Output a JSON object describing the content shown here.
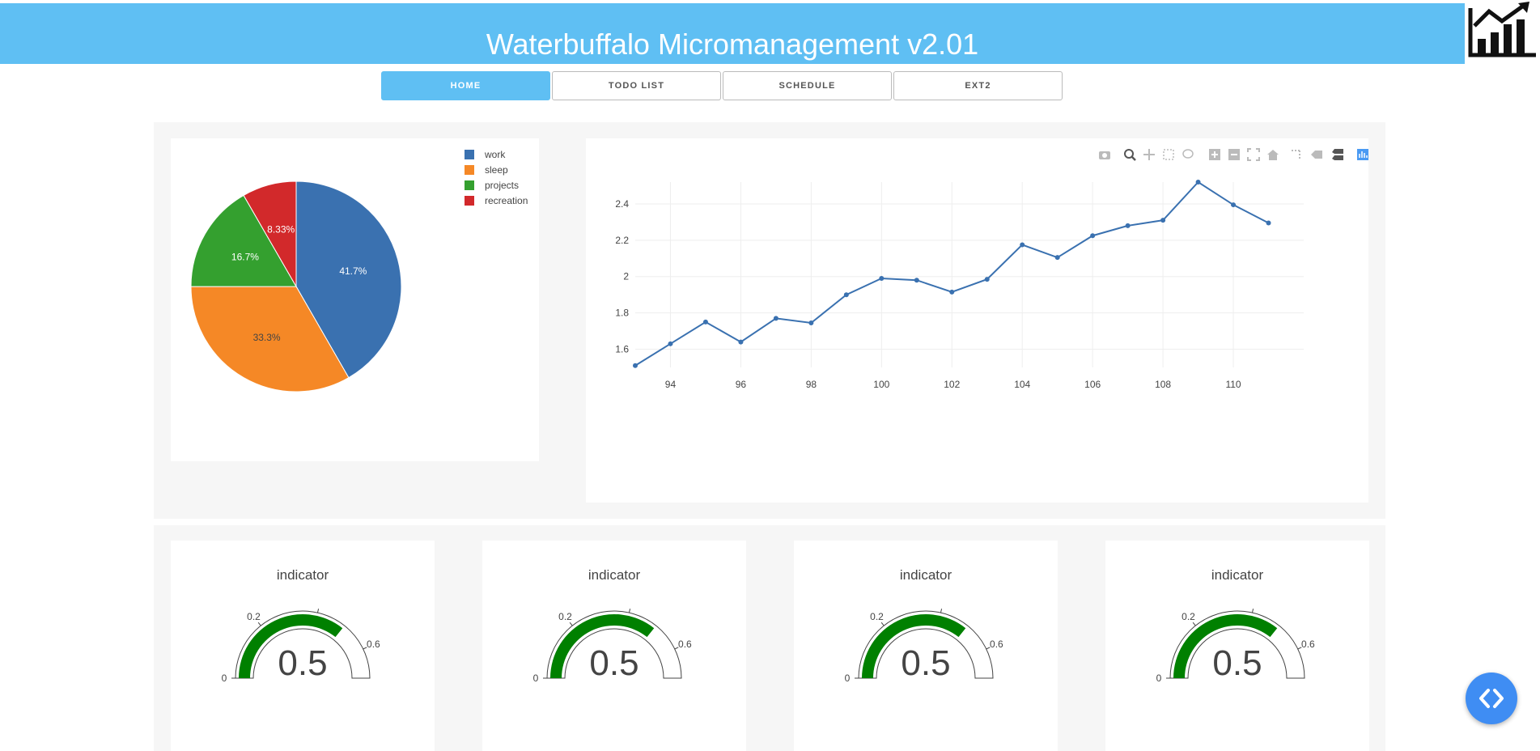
{
  "header": {
    "title": "Waterbuffalo Micromanagement v2.01",
    "logo_icon": "chart-logo-icon",
    "color": "#5fbff3"
  },
  "tabs": [
    {
      "label": "HOME",
      "active": true
    },
    {
      "label": "TODO LIST",
      "active": false
    },
    {
      "label": "SCHEDULE",
      "active": false
    },
    {
      "label": "EXT2",
      "active": false
    }
  ],
  "pie_chart": {
    "chart_data": {
      "type": "pie",
      "labels": [
        "work",
        "sleep",
        "projects",
        "recreation"
      ],
      "values": [
        41.7,
        33.3,
        16.7,
        8.33
      ],
      "value_labels": [
        "41.7%",
        "33.3%",
        "16.7%",
        "8.33%"
      ],
      "colors": [
        "#3a71b0",
        "#f58826",
        "#34a02f",
        "#d2292b"
      ],
      "legend": "top-right"
    }
  },
  "line_chart": {
    "modebar_icons": [
      "camera-icon",
      "zoom-icon",
      "pan-icon",
      "box-select-icon",
      "lasso-icon",
      "zoom-in-icon",
      "zoom-out-icon",
      "autoscale-icon",
      "reset-axes-icon",
      "spike-lines-icon",
      "hover-closest-icon",
      "hover-compare-icon",
      "plotly-logo-icon"
    ],
    "chart_data": {
      "type": "line",
      "series": [
        {
          "x": [
            93,
            94,
            95,
            96,
            97,
            98,
            99,
            100,
            101,
            102,
            103,
            104,
            105,
            106,
            107,
            108,
            109,
            110,
            111
          ],
          "y": [
            1.51,
            1.63,
            1.75,
            1.64,
            1.77,
            1.745,
            1.9,
            1.99,
            1.98,
            1.915,
            1.985,
            2.175,
            2.105,
            2.225,
            2.28,
            2.31,
            2.52,
            2.395,
            2.295
          ]
        }
      ],
      "color": "#3a71b0",
      "xticks": [
        94,
        96,
        98,
        100,
        102,
        104,
        106,
        108,
        110
      ],
      "yticks": [
        1.6,
        1.8,
        2,
        2.2,
        2.4
      ],
      "ytick_labels": [
        "1.6",
        "1.8",
        "2",
        "2.2",
        "2.4"
      ],
      "xlim": [
        93,
        112
      ],
      "ylim": [
        1.5,
        2.52
      ],
      "grid": true
    }
  },
  "gauges": [
    {
      "title": "indicator",
      "value_text": "0.5",
      "value": 0.5,
      "range": [
        0,
        0.7
      ],
      "ticks": [
        "0",
        "0.2",
        "0.4",
        "0.6"
      ],
      "bar_color": "#008000"
    },
    {
      "title": "indicator",
      "value_text": "0.5",
      "value": 0.5,
      "range": [
        0,
        0.7
      ],
      "ticks": [
        "0",
        "0.2",
        "0.4",
        "0.6"
      ],
      "bar_color": "#008000"
    },
    {
      "title": "indicator",
      "value_text": "0.5",
      "value": 0.5,
      "range": [
        0,
        0.7
      ],
      "ticks": [
        "0",
        "0.2",
        "0.4",
        "0.6"
      ],
      "bar_color": "#008000"
    },
    {
      "title": "indicator",
      "value_text": "0.5",
      "value": 0.5,
      "range": [
        0,
        0.7
      ],
      "ticks": [
        "0",
        "0.2",
        "0.4",
        "0.6"
      ],
      "bar_color": "#008000"
    }
  ],
  "fab": {
    "icon": "code-icon",
    "color": "#3f8df3"
  }
}
